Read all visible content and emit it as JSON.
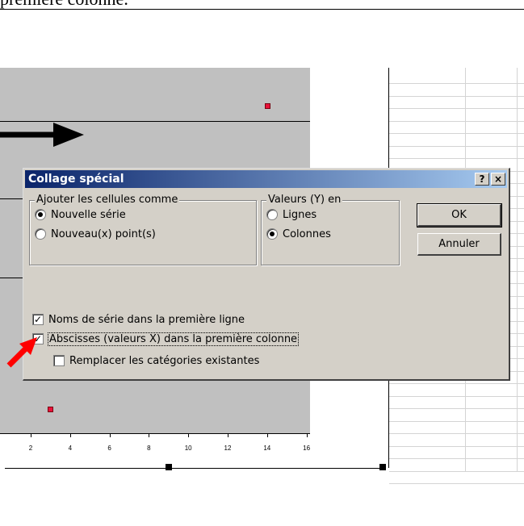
{
  "doc": {
    "top_text": "première colonne."
  },
  "chart_data": {
    "type": "scatter",
    "x_ticks": [
      "2",
      "4",
      "6",
      "8",
      "10",
      "12",
      "14",
      "16"
    ],
    "series": [
      {
        "x": [
          3,
          14
        ],
        "y": [
          0.05,
          0.95
        ]
      }
    ],
    "marker_color": "#e8123a",
    "plot_background": "#c0c0c0"
  },
  "dialog": {
    "title": "Collage spécial",
    "help_label": "?",
    "close_label": "×",
    "group_add": {
      "title": "Ajouter les cellules comme",
      "options": [
        {
          "label": "Nouvelle série",
          "selected": true
        },
        {
          "label": "Nouveau(x) point(s)",
          "selected": false
        }
      ]
    },
    "group_values": {
      "title": "Valeurs (Y) en",
      "options": [
        {
          "label": "Lignes",
          "selected": false
        },
        {
          "label": "Colonnes",
          "selected": true
        }
      ]
    },
    "checkboxes": [
      {
        "label": "Noms de série dans la première ligne",
        "checked": true
      },
      {
        "label": "Abscisses (valeurs X) dans la première colonne",
        "checked": true
      },
      {
        "label": "Remplacer les catégories existantes",
        "checked": false
      }
    ],
    "ok_label": "OK",
    "cancel_label": "Annuler",
    "titlebar_colors": [
      "#0a246a",
      "#a6caf0"
    ],
    "face_color": "#d4d0c8"
  },
  "annotations": {
    "black_arrow_icon": "arrow-right-icon",
    "red_arrow_icon": "arrow-pointer-icon",
    "red_arrow_color": "#ff0000"
  }
}
